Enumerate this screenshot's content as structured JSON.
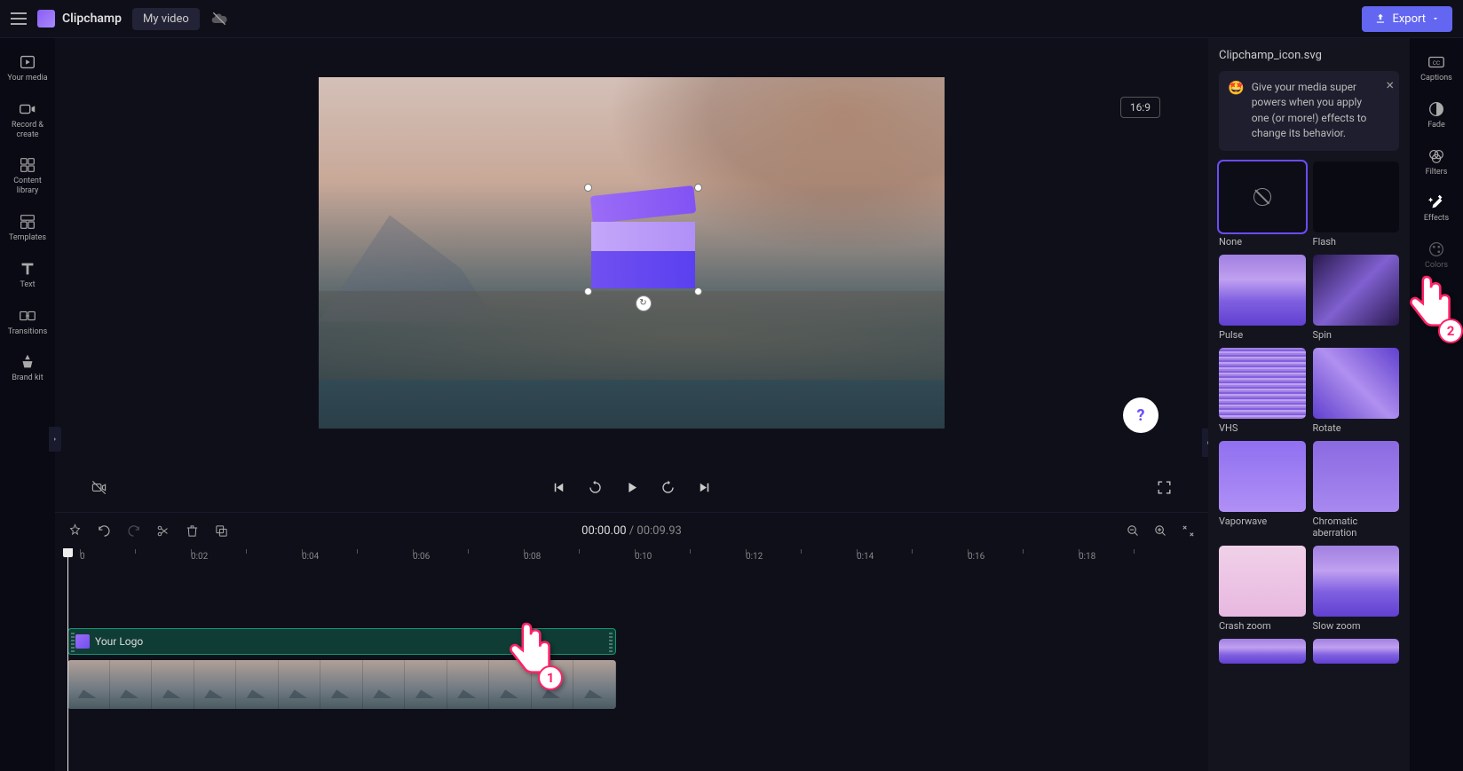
{
  "header": {
    "brand": "Clipchamp",
    "videoName": "My video",
    "exportLabel": "Export"
  },
  "leftRail": {
    "items": [
      {
        "label": "Your media"
      },
      {
        "label": "Record & create"
      },
      {
        "label": "Content library"
      },
      {
        "label": "Templates"
      },
      {
        "label": "Text"
      },
      {
        "label": "Transitions"
      },
      {
        "label": "Brand kit"
      }
    ]
  },
  "preview": {
    "aspect": "16:9"
  },
  "transport": {
    "current": "00:00.00",
    "sep": " / ",
    "duration": "00:09.93"
  },
  "ruler": {
    "labels": [
      "0",
      "0:02",
      "0:04",
      "0:06",
      "0:08",
      "0:10",
      "0:12",
      "0:14",
      "0:16",
      "0:18"
    ]
  },
  "timeline": {
    "logoClip": "Your Logo"
  },
  "rightPanel": {
    "fileName": "Clipchamp_icon.svg",
    "tip": "Give your media super powers when you apply one (or more!) effects to change its behavior.",
    "effects": [
      {
        "label": "None",
        "cls": "et-none",
        "selected": true
      },
      {
        "label": "Flash",
        "cls": "et-flash"
      },
      {
        "label": "Pulse",
        "cls": "et-grad"
      },
      {
        "label": "Spin",
        "cls": "et-spin"
      },
      {
        "label": "VHS",
        "cls": "et-vhs"
      },
      {
        "label": "Rotate",
        "cls": "et-rotate"
      },
      {
        "label": "Vaporwave",
        "cls": "et-vapor"
      },
      {
        "label": "Chromatic aberration",
        "cls": "et-chrom"
      },
      {
        "label": "Crash zoom",
        "cls": "et-crash"
      },
      {
        "label": "Slow zoom",
        "cls": "et-grad"
      }
    ]
  },
  "rightRail": {
    "items": [
      {
        "label": "Captions"
      },
      {
        "label": "Fade"
      },
      {
        "label": "Filters"
      },
      {
        "label": "Effects"
      },
      {
        "label": "Colors"
      }
    ]
  },
  "pointers": {
    "p1": "1",
    "p2": "2"
  }
}
